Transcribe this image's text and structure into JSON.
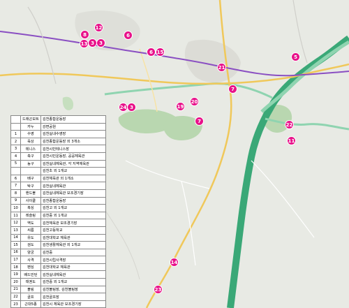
{
  "colors": {
    "river": "#3aa877",
    "river_light": "#8fd4b0",
    "forest": "#b9d7b0",
    "marker": "#e8128a",
    "rail": "#8a4fc2",
    "road": "#f0c85a"
  },
  "markers": [
    {
      "id": "marker-12",
      "label": "12"
    },
    {
      "id": "marker-6-top",
      "label": "6"
    },
    {
      "id": "marker-8",
      "label": "8"
    },
    {
      "id": "marker-13",
      "label": "13"
    },
    {
      "id": "marker-3",
      "label": "3"
    },
    {
      "id": "marker-3b",
      "label": "3"
    },
    {
      "id": "marker-6-mid",
      "label": "6"
    },
    {
      "id": "marker-15",
      "label": "15"
    },
    {
      "id": "marker-5",
      "label": "5"
    },
    {
      "id": "marker-21",
      "label": "21"
    },
    {
      "id": "marker-7",
      "label": "7"
    },
    {
      "id": "marker-24",
      "label": "24"
    },
    {
      "id": "marker-3c",
      "label": "3"
    },
    {
      "id": "marker-19",
      "label": "19"
    },
    {
      "id": "marker-20",
      "label": "20"
    },
    {
      "id": "marker-7b",
      "label": "7"
    },
    {
      "id": "marker-22",
      "label": "22"
    },
    {
      "id": "marker-11",
      "label": "11"
    },
    {
      "id": "marker-14",
      "label": "14"
    },
    {
      "id": "marker-23",
      "label": "23"
    }
  ],
  "legend": {
    "header": [
      "",
      "드래곤보트",
      "김천종합운동장"
    ],
    "rows": [
      {
        "num": "",
        "name": "카누",
        "place": "강변공원"
      },
      {
        "num": "1",
        "name": "수영",
        "place": "김천실내수영장"
      },
      {
        "num": "2",
        "name": "육상",
        "place": "김천종합운동장 외 3개소"
      },
      {
        "num": "3",
        "name": "테니스",
        "place": "김천시민테니스장"
      },
      {
        "num": "4",
        "name": "축구",
        "place": "김천시민운동장, 공공체육관"
      },
      {
        "num": "5",
        "name": "농구",
        "place": "김천실내체육관, 각 지역체육관"
      },
      {
        "num": "",
        "name": "",
        "place": "김천초 외 1개교"
      },
      {
        "num": "6",
        "name": "배구",
        "place": "김천체육관 외 1개소"
      },
      {
        "num": "7",
        "name": "탁구",
        "place": "김천실내체육관"
      },
      {
        "num": "8",
        "name": "핸드볼",
        "place": "김천실내체육관 보조경기장"
      },
      {
        "num": "9",
        "name": "사이클",
        "place": "김천종합운동장"
      },
      {
        "num": "10",
        "name": "복싱",
        "place": "김천고 외 1개교"
      },
      {
        "num": "11",
        "name": "레슬링",
        "place": "김천중 외 1개교"
      },
      {
        "num": "12",
        "name": "역도",
        "place": "김천체육관 보조경기장"
      },
      {
        "num": "13",
        "name": "씨름",
        "place": "김천고등학교"
      },
      {
        "num": "14",
        "name": "유도",
        "place": "김천대학교 체육관"
      },
      {
        "num": "15",
        "name": "검도",
        "place": "김천생활체육관 외 1개교"
      },
      {
        "num": "16",
        "name": "양궁",
        "place": "김천중"
      },
      {
        "num": "17",
        "name": "사격",
        "place": "김천시립사격장"
      },
      {
        "num": "18",
        "name": "펜싱",
        "place": "김천대학교 체육관"
      },
      {
        "num": "19",
        "name": "배드민턴",
        "place": "김천실내체육관"
      },
      {
        "num": "20",
        "name": "태권도",
        "place": "김천중 외 1개교"
      },
      {
        "num": "21",
        "name": "볼링",
        "place": "김천볼링장, 김천볼링장"
      },
      {
        "num": "22",
        "name": "골프",
        "place": "김천골프장"
      },
      {
        "num": "23",
        "name": "근대5종",
        "place": "김천시 체육관 보조경기장"
      },
      {
        "num": "24",
        "name": "소프트볼",
        "place": "김천실내체육관"
      },
      {
        "num": "25",
        "name": "에어로빅",
        "place": "김천체육관 보조경기장"
      }
    ]
  }
}
